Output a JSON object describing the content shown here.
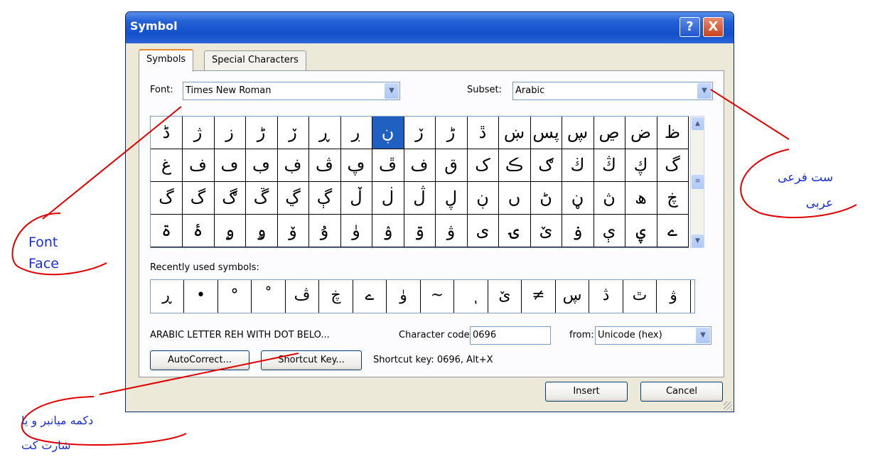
{
  "dialog": {
    "title": "Symbol",
    "help_label": "?",
    "close_label": "X",
    "tabs": [
      "Symbols",
      "Special Characters"
    ],
    "font_label": "Font:",
    "font_value": "Times New Roman",
    "subset_label": "Subset:",
    "subset_value": "Arabic",
    "grid": [
      [
        "ڈ",
        "ژ",
        "ز",
        "ڑ",
        "ڒ",
        "ڕ",
        "ڔ",
        "ړ",
        "ڒ",
        "ڑ",
        "ڐ",
        "ښ",
        "پس",
        "ڛ",
        "ڝ",
        "ض",
        "ظ"
      ],
      [
        "غ",
        "ف",
        "ڡ",
        "ڢ",
        "ڣ",
        "ڤ",
        "ڥ",
        "ڦ",
        "ف",
        "ق",
        "ک",
        "ڪ",
        "ګ",
        "ڬ",
        "ڭ",
        "ڮ",
        "گ"
      ],
      [
        "گ",
        "گ",
        "ڰ",
        "ڱ",
        "ڲ",
        "ڳ",
        "ڵ",
        "ڶ",
        "ڷ",
        "ڸ",
        "ڹ",
        "ں",
        "ڻ",
        "ڼ",
        "ڽ",
        "ھ",
        "ڿ"
      ],
      [
        "ۃ",
        "ۂ",
        "ۄ",
        "ۅ",
        "ۆ",
        "ۇ",
        "ۈ",
        "ۉ",
        "ۊ",
        "ۋ",
        "ی",
        "ۍ",
        "ێ",
        "ۏ",
        "ې",
        "ۑ",
        "ے"
      ]
    ],
    "selected_cell": "ڹ",
    "recent_label": "Recently used symbols:",
    "recent": [
      "ڕ",
      "•",
      "°",
      "˚",
      "ڤ",
      "ڿ",
      "ے",
      "ۈ",
      "~",
      "ٖ",
      "ێ",
      "≠",
      "ڛ",
      "ڎ",
      "ٿ",
      "ۋ"
    ],
    "char_name": "ARABIC LETTER REH WITH DOT BELO...",
    "char_code_label": "Character code:",
    "char_code_value": "0696",
    "from_label": "from:",
    "from_value": "Unicode (hex)",
    "autocorrect_label": "AutoCorrect...",
    "shortcut_key_label": "Shortcut Key...",
    "shortcut_info": "Shortcut key: 0696, Alt+X",
    "insert_label": "Insert",
    "cancel_label": "Cancel"
  },
  "annotations": {
    "font_face": [
      "Font",
      "Face"
    ],
    "subset_note": [
      "ست فرعی",
      "عربی"
    ],
    "shortcut_note": [
      "دکمه میانبر و یا",
      "شارت کت"
    ]
  },
  "colors": {
    "selection": "#2060c0",
    "annotation_line": "#e00000",
    "annotation_text": "#1a2fd0"
  }
}
